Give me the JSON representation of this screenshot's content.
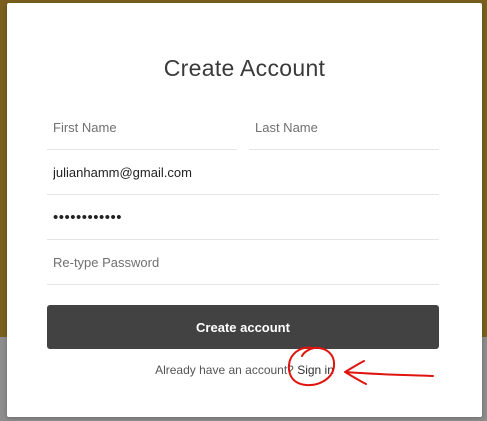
{
  "form": {
    "title": "Create Account",
    "first_name": {
      "value": "",
      "placeholder": "First Name"
    },
    "last_name": {
      "value": "",
      "placeholder": "Last Name"
    },
    "email": {
      "value": "julianhamm@gmail.com",
      "placeholder": ""
    },
    "password": {
      "value": "••••••••••••",
      "placeholder": ""
    },
    "retype_password": {
      "value": "",
      "placeholder": "Re-type Password"
    },
    "submit_label": "Create account",
    "signin_prompt": "Already have an account?",
    "signin_link": "Sign in"
  },
  "colors": {
    "backdrop_top": "#7a5f1f",
    "backdrop_bottom": "#8d8d8d",
    "button": "#424242",
    "annotation": "#e0140f"
  }
}
